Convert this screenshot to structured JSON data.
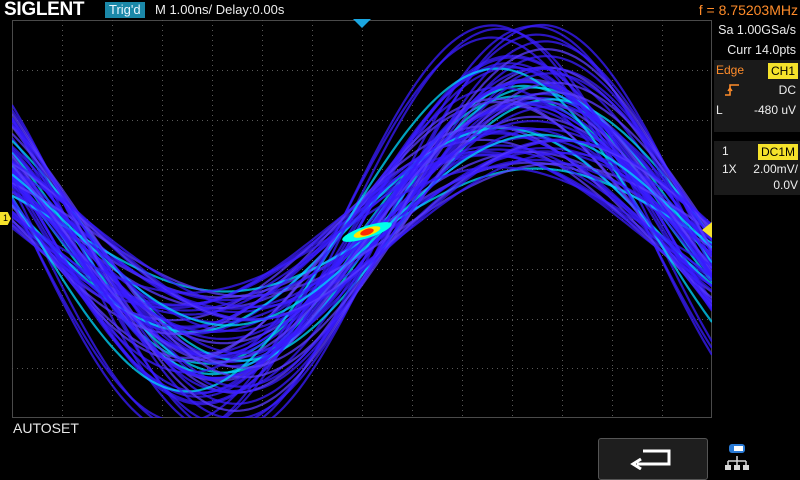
{
  "header": {
    "brand": "SIGLENT",
    "trig_status": "Trig'd",
    "timebase": "M 1.00ns/  Delay:0.00s",
    "frequency": "f = 8.75203MHz"
  },
  "acquisition": {
    "sample_rate": "Sa 1.00GSa/s",
    "record_length": "Curr 14.0pts"
  },
  "trigger": {
    "type_label": "Edge",
    "source": "CH1",
    "coupling": "DC",
    "level_label": "L",
    "level_value": "-480 uV",
    "slope_icon": "rising-edge-icon"
  },
  "channel": {
    "number": "1",
    "coupling_impedance": "DC1M",
    "probe": "1X",
    "vdiv": "2.00mV/",
    "offset": "0.0V",
    "marker_label": "1"
  },
  "footer": {
    "status_message": "AUTOSET",
    "back_icon": "return-arrow-icon",
    "network_icon": "network-status-icon"
  },
  "colors": {
    "trace_base": "#3a1cff",
    "trace_warm": "#00e6ff",
    "trigger_orange": "#ff8c2a",
    "channel_yellow": "#f5e22b",
    "trig_badge": "#1b88a8"
  }
}
